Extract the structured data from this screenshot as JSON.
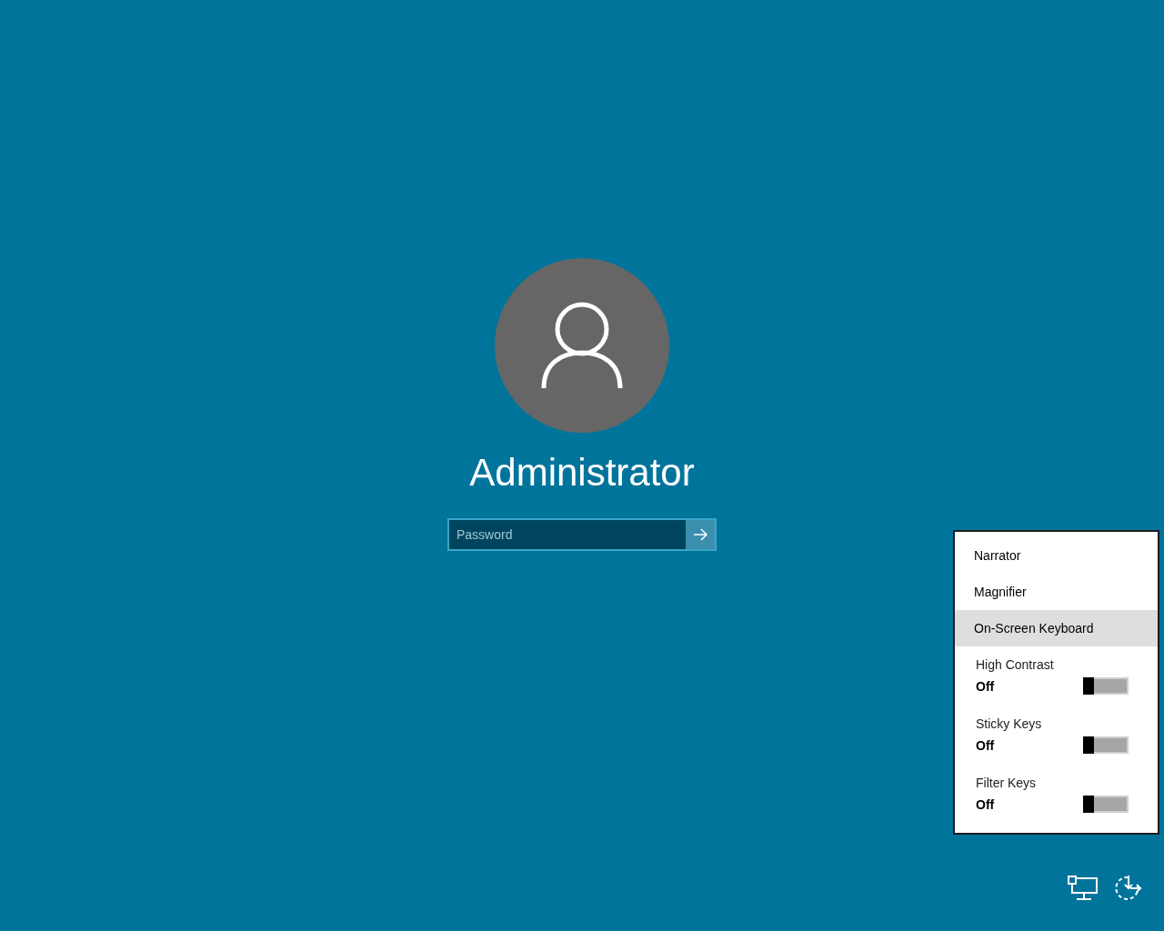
{
  "user": {
    "name": "Administrator"
  },
  "password": {
    "placeholder": "Password"
  },
  "ease_of_access_menu": {
    "items": [
      {
        "kind": "link",
        "label": "Narrator",
        "selected": false
      },
      {
        "kind": "link",
        "label": "Magnifier",
        "selected": false
      },
      {
        "kind": "link",
        "label": "On-Screen Keyboard",
        "selected": true
      },
      {
        "kind": "toggle",
        "label": "High Contrast",
        "state": "Off",
        "on": false
      },
      {
        "kind": "toggle",
        "label": "Sticky Keys",
        "state": "Off",
        "on": false
      },
      {
        "kind": "toggle",
        "label": "Filter Keys",
        "state": "Off",
        "on": false
      }
    ]
  }
}
